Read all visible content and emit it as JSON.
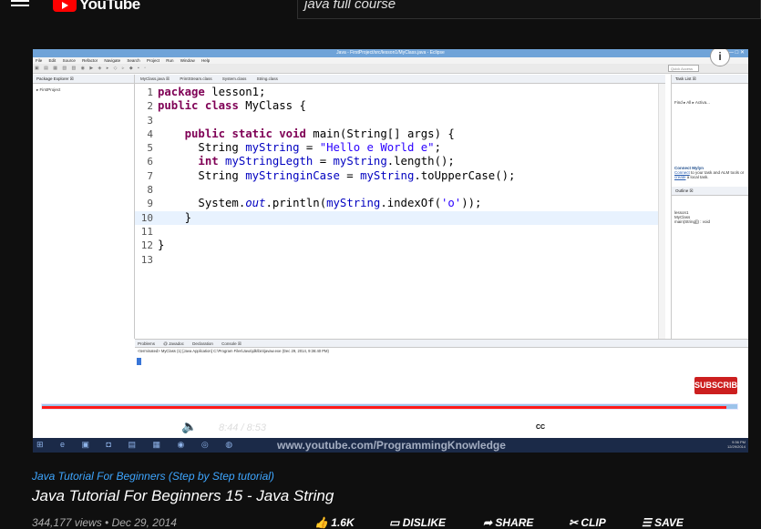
{
  "youtube": {
    "logo_text": "YouTube",
    "search_value": "java full course"
  },
  "eclipse": {
    "window_title": "Java - FirstProject/src/lesson1/MyClass.java - Eclipse",
    "window_buttons": "— □ ✕",
    "menu": [
      "File",
      "Edit",
      "Source",
      "Refactor",
      "Navigate",
      "Search",
      "Project",
      "Run",
      "Window",
      "Help"
    ],
    "toolbar_icons": "▣ ▤ ▦ ▧ ▨ ◉ ▶ ◈ ▸ ◇ ▹ ◆ ▪ ▫",
    "quick_access": "Quick Access",
    "info_icon": "i",
    "package_explorer_tab": "Package Explorer ☒",
    "project": "FirstProject",
    "editor_tabs": [
      "MyClass.java ☒",
      "PrintStream.class",
      "System.class",
      "String.class"
    ],
    "line_numbers": [
      "1",
      "2",
      "3",
      "4",
      "5",
      "6",
      "7",
      "8",
      "9",
      "10",
      "11",
      "12",
      "13"
    ],
    "code": {
      "l1_kw": "package",
      "l1_rest": " lesson1;",
      "l2_kw1": "public",
      "l2_kw2": "class",
      "l2_rest": " MyClass {",
      "l4_indent": "    ",
      "l4_kw1": "public",
      "l4_kw2": "static",
      "l4_kw3": "void",
      "l4_rest": " main(String[] args) {",
      "l5_a": "      String ",
      "l5_var": "myString",
      "l5_b": " = ",
      "l5_str": "\"Hello e World e\"",
      "l5_c": ";",
      "l6_indent": "      ",
      "l6_kw": "int",
      "l6_sp": " ",
      "l6_var": "myStringLegth",
      "l6_b": " = ",
      "l6_var2": "myString",
      "l6_c": ".length();",
      "l7_a": "      String ",
      "l7_var": "myStringinCase",
      "l7_b": " = ",
      "l7_var2": "myString",
      "l7_c": ".toUpperCase();",
      "l9_a": "      System.",
      "l9_out": "out",
      "l9_b": ".println(",
      "l9_var": "myString",
      "l9_c": ".indexOf(",
      "l9_str": "'o'",
      "l9_d": "));",
      "l10": "    }",
      "l12": "}"
    },
    "task_list_tab": "Task List ☒",
    "find_label": "Find",
    "all_label": "All",
    "activate_label": "Activa...",
    "mylyn_title": "Connect Mylyn",
    "mylyn_connect": "Connect",
    "mylyn_text1": " to your task and ALM tools or ",
    "mylyn_create": "create",
    "mylyn_text2": " a local task.",
    "outline_tab": "Outline ☒",
    "outline_items": [
      "lesson1",
      "MyClass",
      "main(String[]) : void"
    ],
    "console_tabs": [
      "Problems",
      "@ Javadoc",
      "Declaration",
      "Console ☒"
    ],
    "console_line": "<terminated> MyClass (1) [Java Application] C:\\Program Files\\Java\\jdk\\bin\\javaw.exe (Dec 29, 2014, 9:36:40 PM)",
    "console_output": "4"
  },
  "player": {
    "subscribe": "SUBSCRIBE",
    "time": "8:44 / 8:53",
    "progress": 0.984,
    "cc": "CC",
    "icons": {
      "prev": "⏮",
      "play": "▶",
      "next": "⏭",
      "volume": "🔈",
      "settings": "⚙",
      "miniplayer": "⧉",
      "theater": "▭",
      "fullscreen": "⛶"
    },
    "taskbar_icons": "⊞ e ▣ ◘ ▤ ▦ ◉ ◎ ◍",
    "watermark": "www.youtube.com/ProgrammingKnowledge",
    "clock_time": "9:36 PM",
    "clock_date": "12/29/2014"
  },
  "meta": {
    "series": "Java Tutorial For Beginners (Step by Step tutorial)",
    "title": "Java Tutorial For Beginners 15 - Java String",
    "views": "344,177 views • Dec 29, 2014",
    "like": "1.6K",
    "dislike": "DISLIKE",
    "share": "SHARE",
    "clip": "CLIP",
    "save": "SAVE"
  }
}
